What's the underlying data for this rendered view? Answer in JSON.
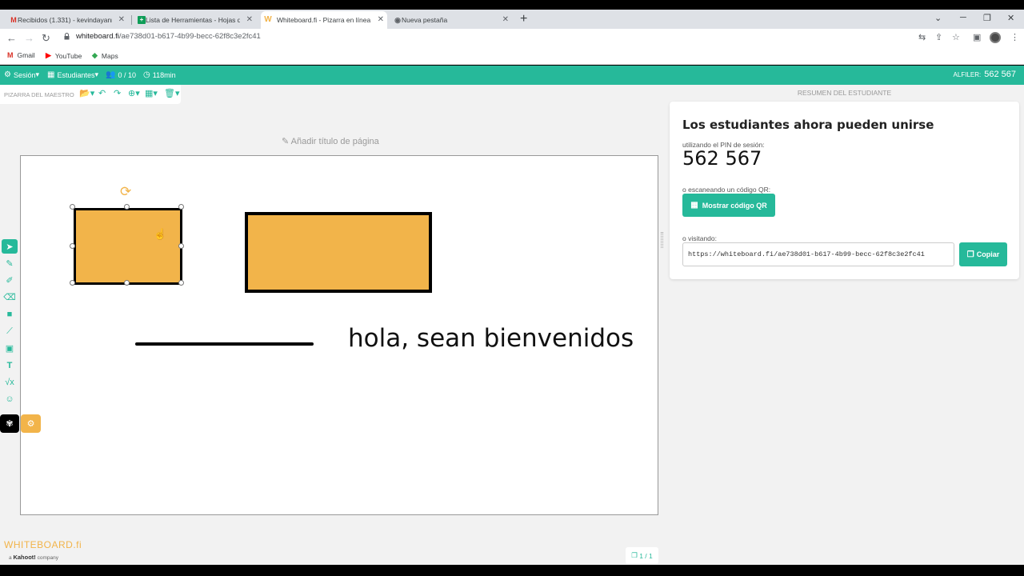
{
  "browser": {
    "tabs": [
      {
        "title": "Recibidos (1.331) - kevindayanm",
        "icon": "gmail-icon"
      },
      {
        "title": "Lista de Herramientas - Hojas de",
        "icon": "sheets-icon"
      },
      {
        "title": "Whiteboard.fi - Pizarra en línea p",
        "icon": "whiteboard-icon"
      },
      {
        "title": "Nueva pestaña",
        "icon": "chrome-icon"
      }
    ],
    "active_tab": 2,
    "url_host": "whiteboard.fi",
    "url_path": "/ae738d01-b617-4b99-becc-62f8c3e2fc41",
    "bookmarks": [
      "Gmail",
      "YouTube",
      "Maps"
    ]
  },
  "appbar": {
    "session": "Sesión",
    "students": "Estudiantes",
    "count": "0 / 10",
    "time": "118min",
    "pin_label": "ALFILER:",
    "pin_value": "562  567"
  },
  "board": {
    "subbar_label": "PIZARRA DEL MAESTRO",
    "page_title_placeholder": "Añadir título de página",
    "canvas_text": "hola, sean bienvenidos",
    "shape_color": "#f2b44a",
    "accent_color": "#26b99a",
    "page_count": "1 / 1",
    "logo": "WHITEBOARD.fi",
    "logo_sub_a": "a",
    "logo_sub_brand": "Kahoot!",
    "logo_sub_company": "company"
  },
  "side": {
    "header": "RESUMEN DEL ESTUDIANTE",
    "title": "Los estudiantes ahora pueden unirse",
    "pin_hint": "utilizando el PIN de sesión:",
    "pin": "562  567",
    "qr_hint": "o escaneando un código QR:",
    "qr_button": "Mostrar código QR",
    "visit_hint": "o visitando:",
    "join_url": "https://whiteboard.fi/ae738d01-b617-4b99-becc-62f8c3e2fc41",
    "copy_button": "Copiar"
  }
}
